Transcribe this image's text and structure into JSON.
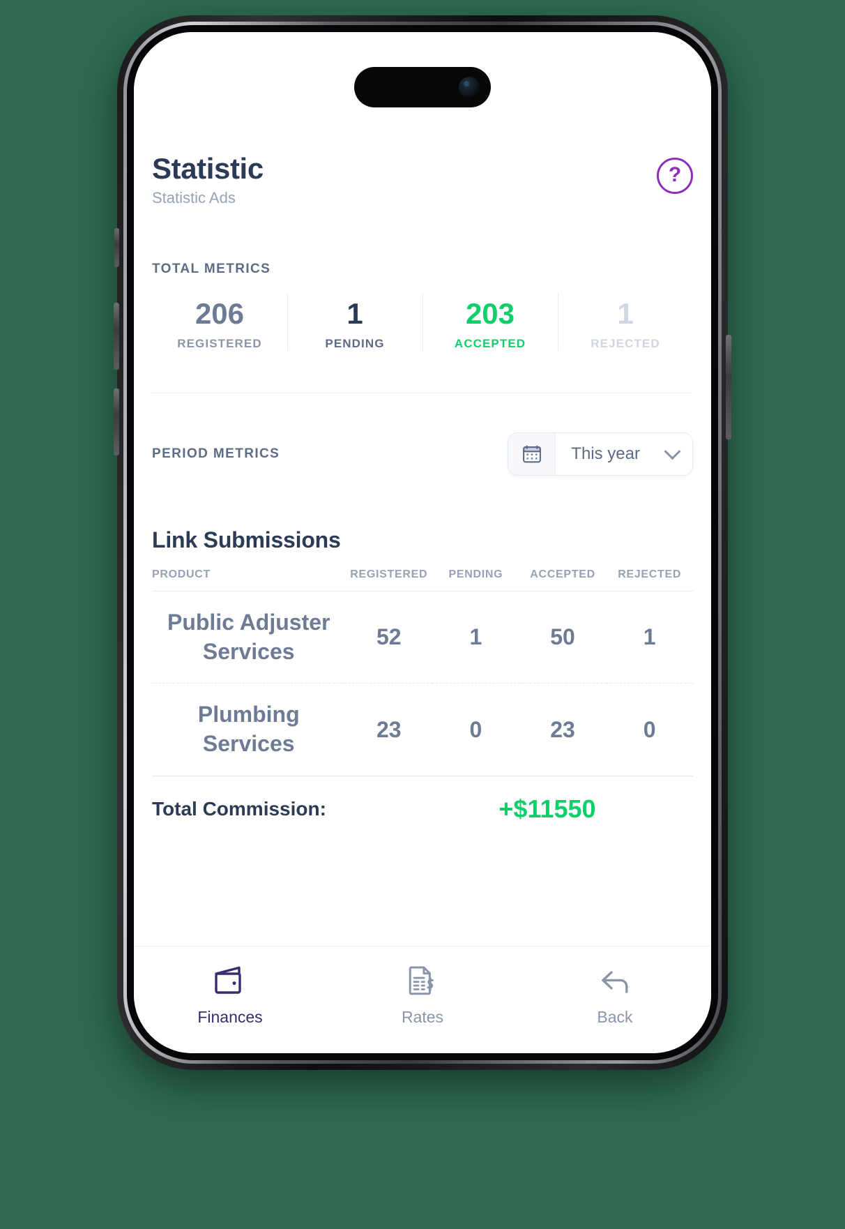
{
  "header": {
    "title": "Statistic",
    "subtitle": "Statistic Ads",
    "help_glyph": "?",
    "accent_purple": "#8c2fb8"
  },
  "total_metrics": {
    "label": "TOTAL METRICS",
    "items": [
      {
        "value": "206",
        "name": "REGISTERED",
        "color": "#6d7b94"
      },
      {
        "value": "1",
        "name": "PENDING",
        "color": "#2b3a55"
      },
      {
        "value": "203",
        "name": "ACCEPTED",
        "color": "#10cf6b"
      },
      {
        "value": "1",
        "name": "REJECTED",
        "color": "#cfd6e1"
      }
    ]
  },
  "period_metrics": {
    "label": "PERIOD METRICS",
    "selected": "This year"
  },
  "submissions": {
    "title": "Link Submissions",
    "columns": {
      "product": "PRODUCT",
      "registered": "REGISTERED",
      "pending": "PENDING",
      "accepted": "ACCEPTED",
      "rejected": "REJECTED"
    },
    "rows": [
      {
        "product": "Public Adjuster Services",
        "registered": "52",
        "pending": "1",
        "accepted": "50",
        "rejected": "1"
      },
      {
        "product": "Plumbing Services",
        "registered": "23",
        "pending": "0",
        "accepted": "23",
        "rejected": "0"
      }
    ],
    "commission_label": "Total Commission:",
    "commission_value": "+$11550",
    "commission_color": "#10cf6b"
  },
  "tabbar": {
    "tabs": [
      {
        "label": "Finances",
        "icon": "wallet-icon",
        "active": true
      },
      {
        "label": "Rates",
        "icon": "document-dollar-icon",
        "active": false
      },
      {
        "label": "Back",
        "icon": "back-arrow-icon",
        "active": false
      }
    ]
  }
}
